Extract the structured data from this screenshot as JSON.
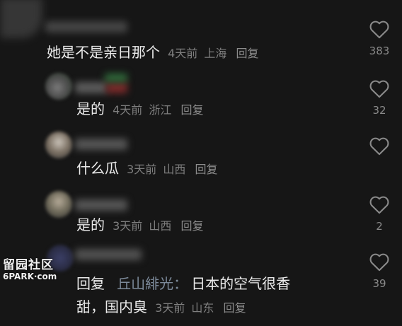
{
  "comments": [
    {
      "text": "她是不是亲日那个",
      "age": "4天前",
      "location": "上海",
      "reply_label": "回复",
      "likes": "383"
    },
    {
      "text": "是的",
      "age": "4天前",
      "location": "浙江",
      "reply_label": "回复",
      "likes": "32"
    },
    {
      "text": "什么瓜",
      "age": "3天前",
      "location": "山西",
      "reply_label": "回复",
      "likes": ""
    },
    {
      "text": "是的",
      "age": "3天前",
      "location": "山西",
      "reply_label": "回复",
      "likes": "2"
    },
    {
      "prefix": "回复",
      "mention": "丘山緋光：",
      "text_line1": "日本的空气很香",
      "text_line2": "甜，国内臭",
      "age": "3天前",
      "location": "山东",
      "reply_label": "回复",
      "likes": "39"
    }
  ],
  "watermark": {
    "title": "留园社区",
    "site": "6PARK·com"
  },
  "icons": {
    "like": "heart-outline-icon"
  },
  "colors": {
    "background": "#161616",
    "text": "#ebebeb",
    "meta": "#7f7f7f"
  }
}
